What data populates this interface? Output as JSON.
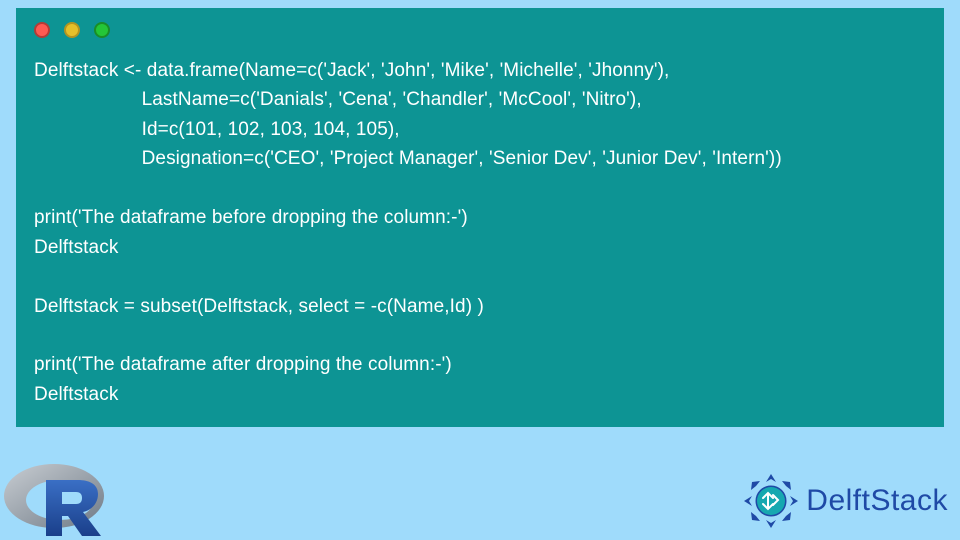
{
  "code": {
    "lines": [
      "Delftstack <- data.frame(Name=c('Jack', 'John', 'Mike', 'Michelle', 'Jhonny'),",
      "                    LastName=c('Danials', 'Cena', 'Chandler', 'McCool', 'Nitro'),",
      "                    Id=c(101, 102, 103, 104, 105),",
      "                    Designation=c('CEO', 'Project Manager', 'Senior Dev', 'Junior Dev', 'Intern'))",
      "",
      "print('The dataframe before dropping the column:-')",
      "Delftstack",
      "",
      "Delftstack = subset(Delftstack, select = -c(Name,Id) )",
      "",
      "print('The dataframe after dropping the column:-')",
      "Delftstack"
    ]
  },
  "branding": {
    "delftstack": "DelftStack"
  },
  "colors": {
    "panel_bg": "#0d9494",
    "page_bg": "#9fdbfb",
    "brand_blue": "#1f4aa6"
  }
}
